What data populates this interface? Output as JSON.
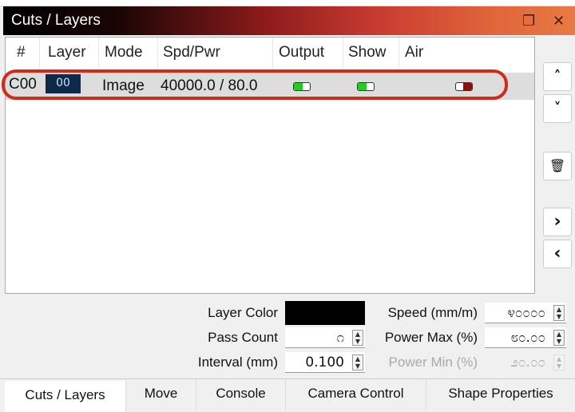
{
  "panel": {
    "title": "Cuts / Layers",
    "float_icon": "restore-icon",
    "close_icon": "close-icon"
  },
  "table": {
    "headers": [
      "#",
      "Layer",
      "Mode",
      "Spd/Pwr",
      "Output",
      "Show",
      "Air"
    ],
    "rows": [
      {
        "num": "C00",
        "layer": "00",
        "mode": "Image",
        "spd_pwr": "40000.0 / 80.0",
        "output": true,
        "show": true,
        "air": false
      }
    ]
  },
  "colors": {
    "layer_color": "#000000",
    "on": "#22cc22",
    "off": "#8b1010",
    "highlight": "#d42a1a"
  },
  "side_buttons": [
    "chevron-up-icon",
    "chevron-down-icon",
    "trash-icon",
    "chevron-right-icon",
    "chevron-left-icon"
  ],
  "side_glyphs": {
    "up": "˄",
    "down": "˅",
    "trash": "🗑",
    "right": "›",
    "left": "‹"
  },
  "props": {
    "layer_color_label": "Layer Color",
    "pass_count_label": "Pass Count",
    "pass_count": "೧",
    "interval_label": "Interval (mm)",
    "interval": "0.100",
    "speed_label": "Speed (mm/m)",
    "speed": "೪೦೦೦೦",
    "power_max_label": "Power Max (%)",
    "power_max": "೮೦.೦೦",
    "power_min_label": "Power Min (%)",
    "power_min": "೨೦.೦೦"
  },
  "tabs": [
    "Cuts / Layers",
    "Move",
    "Console",
    "Camera Control",
    "Shape Properties"
  ],
  "active_tab": "Cuts / Layers"
}
